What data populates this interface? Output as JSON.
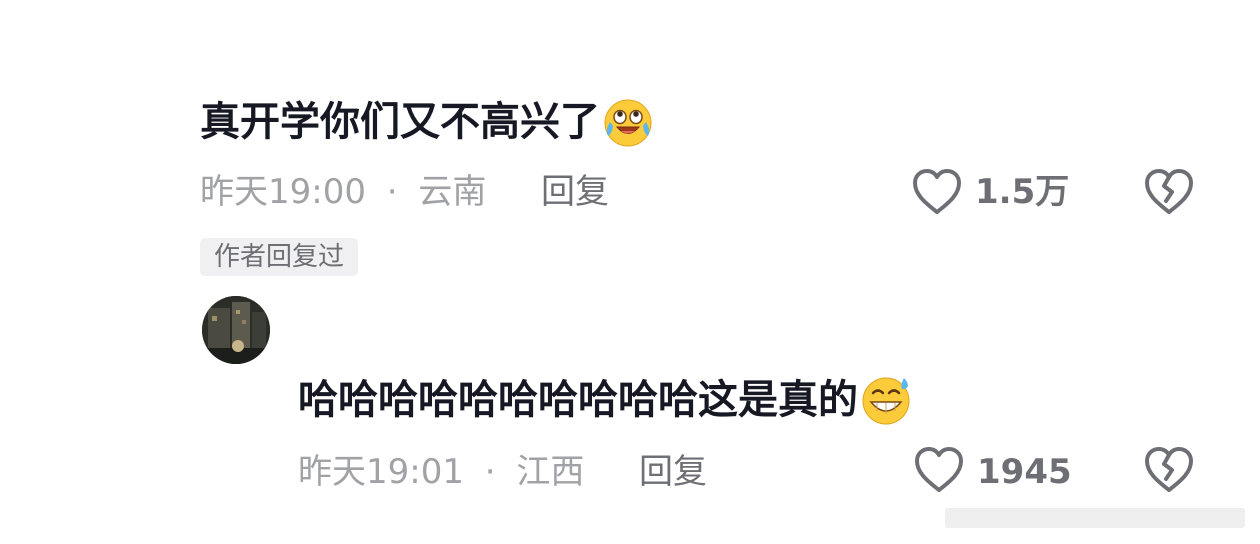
{
  "comment": {
    "text": "真开学你们又不高兴了",
    "emoji": "laughing-crying-emoji",
    "time": "昨天19:00",
    "separator": "·",
    "location": "云南",
    "reply_label": "回复",
    "like_count": "1.5万",
    "author_badge": "作者回复过"
  },
  "reply": {
    "avatar": "user-avatar",
    "text": "哈哈哈哈哈哈哈哈哈哈这是真的",
    "emoji": "grinning-sweat-emoji",
    "time": "昨天19:01",
    "separator": "·",
    "location": "江西",
    "reply_label": "回复",
    "like_count": "1945"
  },
  "icons": {
    "like": "heart-outline-icon",
    "dislike": "broken-heart-icon"
  },
  "colors": {
    "text_primary": "#161823",
    "text_meta": "#a1a2a6",
    "text_secondary": "#6e6f75",
    "badge_bg": "#f0f0f2",
    "emoji_yellow": "#fccb3a"
  }
}
